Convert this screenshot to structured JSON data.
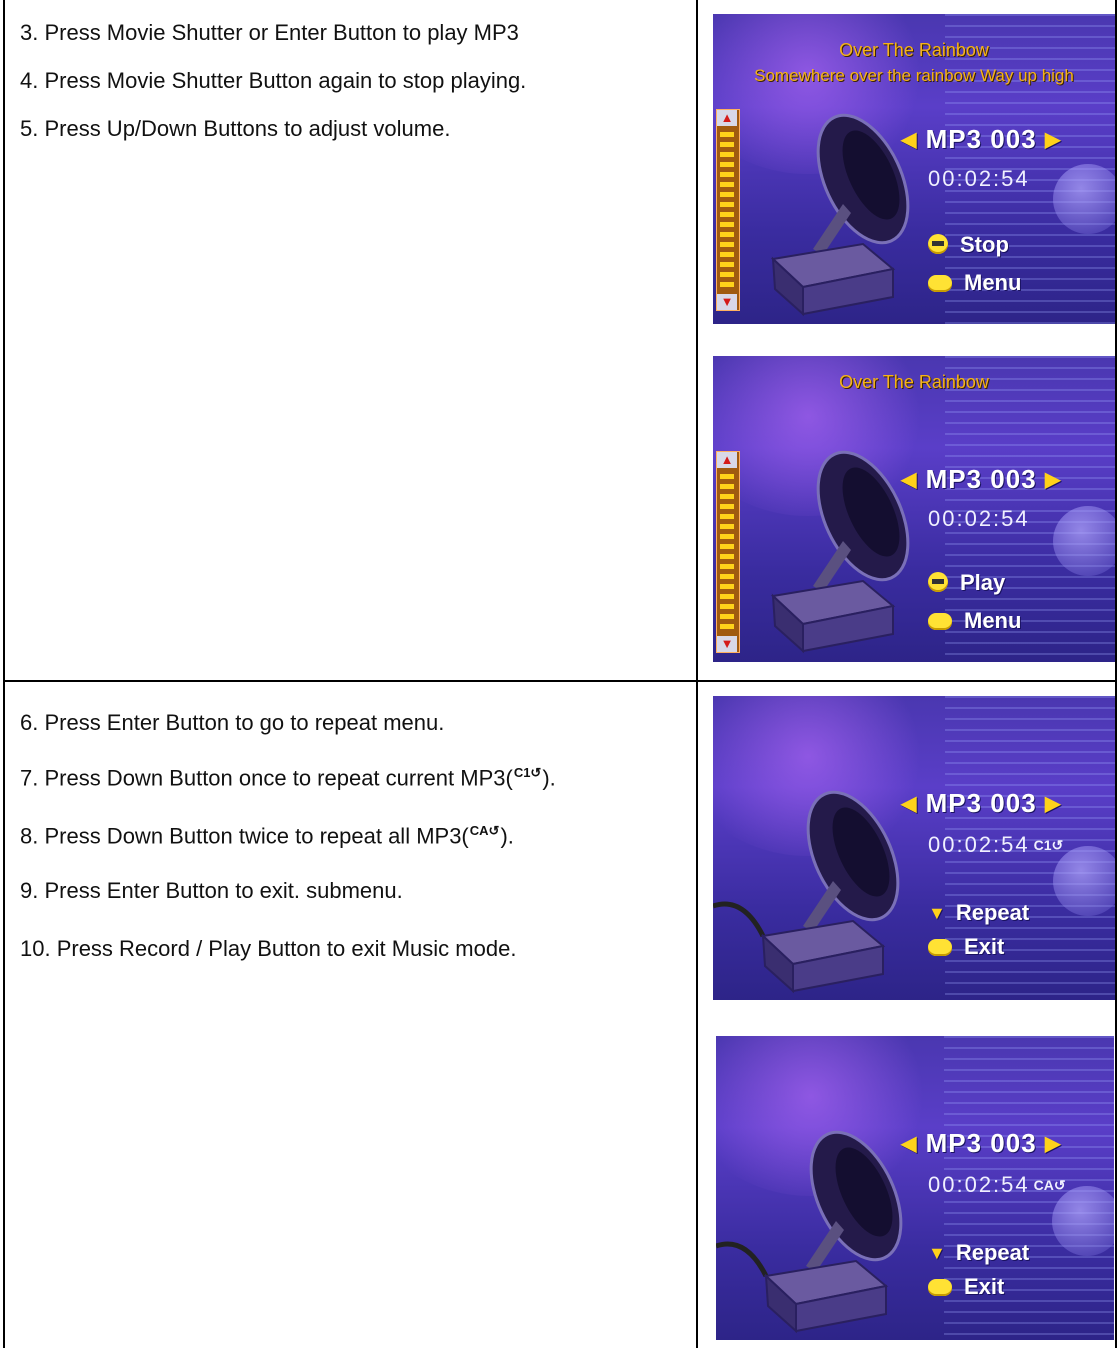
{
  "steps_top": [
    "3. Press Movie Shutter or Enter Button to play MP3",
    "4. Press Movie Shutter Button again to stop playing.",
    "5. Press Up/Down Buttons to adjust volume."
  ],
  "steps_bottom": {
    "s6": "6. Press Enter Button to go to repeat menu.",
    "s7_a": "7. Press Down Button once to repeat current MP3(",
    "s7_icon": "C1↺",
    "s7_b": ").",
    "s8_a": "8. Press Down Button twice to repeat all MP3(",
    "s8_icon": "CA↺",
    "s8_b": ").",
    "s9": "9. Press Enter Button to exit. submenu.",
    "s10": "10. Press Record / Play Button to exit Music mode."
  },
  "screens": [
    {
      "song_title": "Over The Rainbow",
      "lyric": "Somewhere over the rainbow Way up high",
      "track": "MP3 003",
      "time": "00:02:54",
      "mode_icon": "",
      "hint1": "Stop",
      "hint1_icon": "shutter-button-icon",
      "hint2": "Menu"
    },
    {
      "song_title": "Over The Rainbow",
      "lyric": "",
      "track": "MP3 003",
      "time": "00:02:54",
      "mode_icon": "",
      "hint1": "Play",
      "hint1_icon": "shutter-button-icon",
      "hint2": "Menu"
    },
    {
      "song_title": "",
      "lyric": "",
      "track": "MP3 003",
      "time": "00:02:54",
      "mode_icon": "C1↺",
      "hint1": "Repeat",
      "hint1_icon": "down-triangle-icon",
      "hint2": "Exit"
    },
    {
      "song_title": "",
      "lyric": "",
      "track": "MP3 003",
      "time": "00:02:54",
      "mode_icon": "CA↺",
      "hint1": "Repeat",
      "hint1_icon": "down-triangle-icon",
      "hint2": "Exit"
    }
  ],
  "colors": {
    "screen_bg": "#4a37b0",
    "title_text": "#f5b219",
    "accent_yellow": "#ffd21a"
  }
}
